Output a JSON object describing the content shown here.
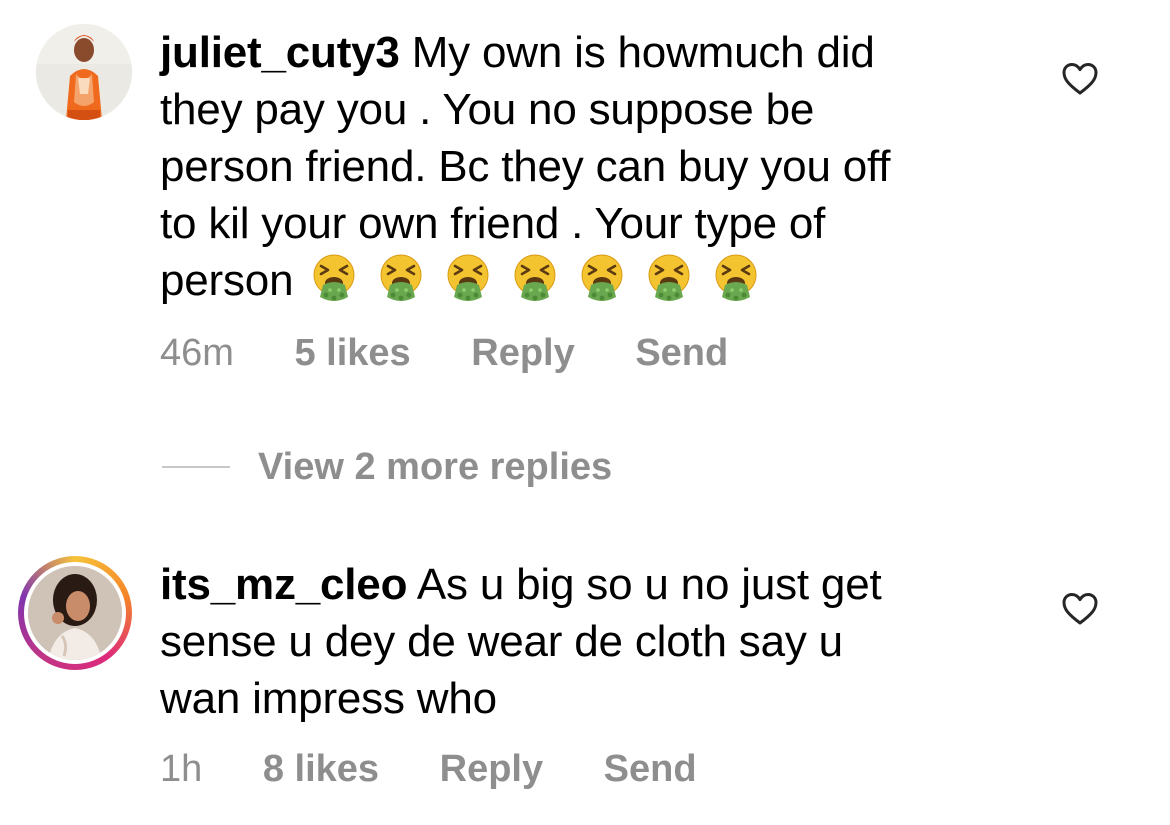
{
  "comments": [
    {
      "username": "juliet_cuty3",
      "text_lines": [
        "My own is howmuch did",
        "they pay you . You no suppose be",
        "person friend. Bc they can buy you off",
        "to kil your own friend . Your type of",
        "person"
      ],
      "emoji_count": 7,
      "emoji_name": "vomiting-face-emoji",
      "time": "46m",
      "likes": "5 likes",
      "reply_label": "Reply",
      "send_label": "Send",
      "has_story_ring": false
    },
    {
      "username": "its_mz_cleo",
      "text_lines": [
        "As u big so u no just get",
        "sense u dey de wear de cloth say u",
        "wan impress who"
      ],
      "time": "1h",
      "likes": "8 likes",
      "reply_label": "Reply",
      "send_label": "Send",
      "has_story_ring": true
    }
  ],
  "view_replies": {
    "label": "View 2 more replies"
  },
  "colors": {
    "text": "#000000",
    "muted": "#8e8e8e",
    "divider": "#c7c7c7",
    "story_ring": [
      "#f6c339",
      "#f58529",
      "#dd2a7b",
      "#c13584",
      "#8134af"
    ],
    "emoji_face": "#f4c430",
    "emoji_vomit": "#6aa84f"
  },
  "icons": {
    "like": "heart-outline-icon"
  }
}
